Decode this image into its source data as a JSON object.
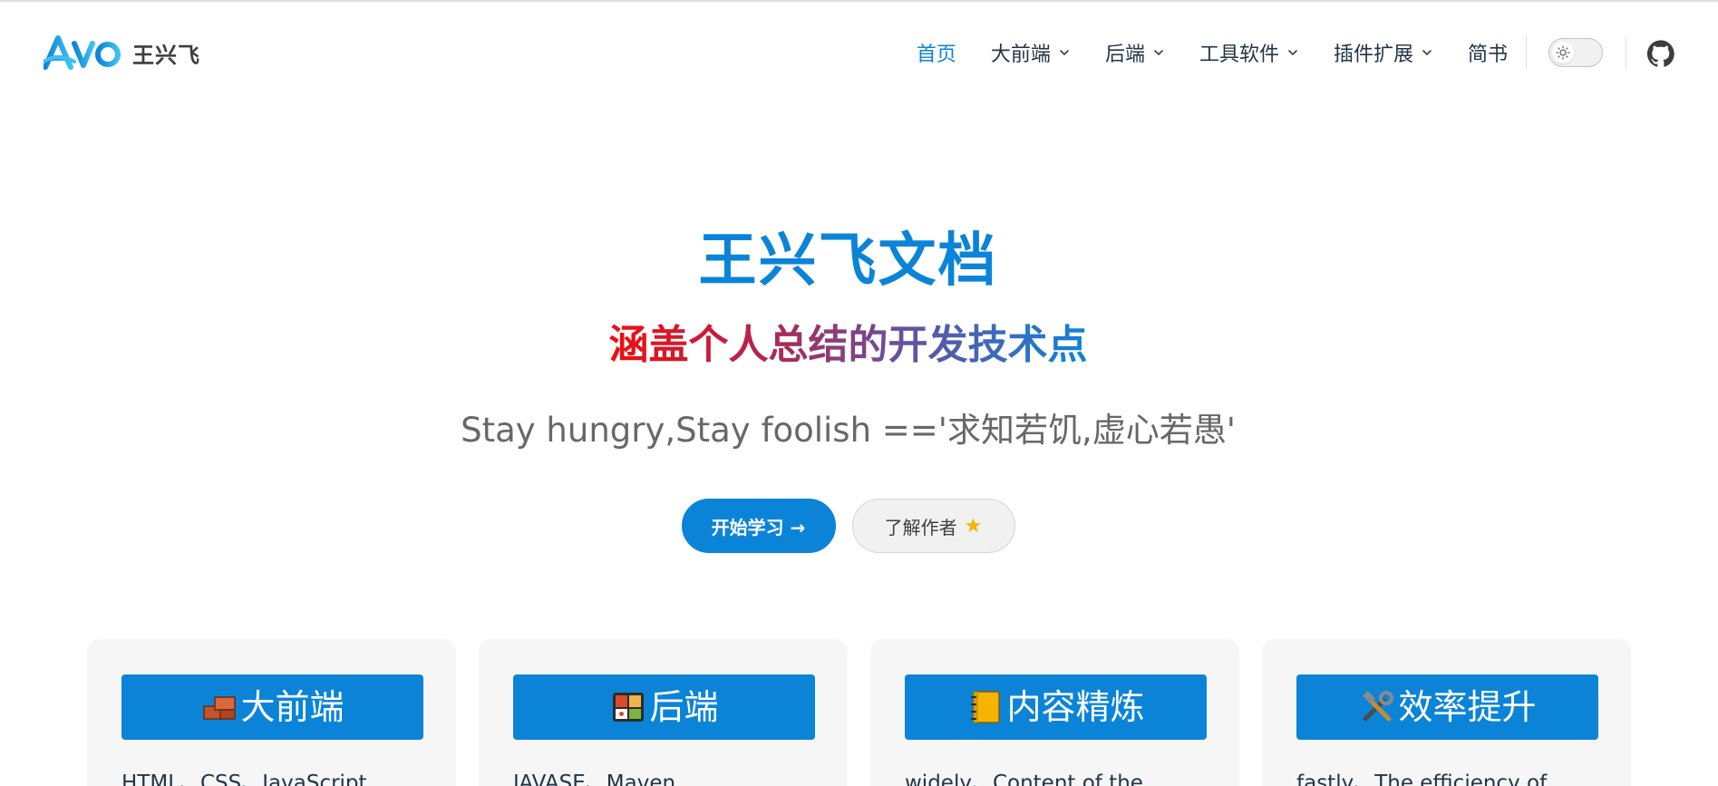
{
  "brand": {
    "logo_text": "AVO",
    "title": "王兴飞"
  },
  "nav": {
    "items": [
      {
        "label": "首页",
        "active": true,
        "dropdown": false
      },
      {
        "label": "大前端",
        "active": false,
        "dropdown": true
      },
      {
        "label": "后端",
        "active": false,
        "dropdown": true
      },
      {
        "label": "工具软件",
        "active": false,
        "dropdown": true
      },
      {
        "label": "插件扩展",
        "active": false,
        "dropdown": true
      },
      {
        "label": "简书",
        "active": false,
        "dropdown": false
      }
    ],
    "theme_toggle_icon": "sun-icon",
    "social_icon": "github-icon"
  },
  "hero": {
    "name": "王兴飞文档",
    "text": "涵盖个人总结的开发技术点",
    "tagline": "Stay hungry,Stay foolish =='求知若饥,虚心若愚'",
    "actions": [
      {
        "label": "开始学习 →",
        "theme": "brand"
      },
      {
        "label": "了解作者",
        "theme": "alt",
        "icon": "star-icon"
      }
    ]
  },
  "features": [
    {
      "icon": "bricks-icon",
      "title": "大前端",
      "details": "HTML、CSS、JavaScript"
    },
    {
      "icon": "bento-box-icon",
      "title": "后端",
      "details": "JAVASE、Maven"
    },
    {
      "icon": "notebook-icon",
      "title": "内容精炼",
      "details": "widely、Content of the"
    },
    {
      "icon": "tools-icon",
      "title": "效率提升",
      "details": "fastly、The efficiency of"
    }
  ],
  "colors": {
    "brand": "#0b84d8",
    "text": "#213547",
    "muted": "#67676c",
    "gradient_start": "#f20d0d",
    "gradient_end": "#0e84d8",
    "card_bg": "#f6f6f7"
  }
}
